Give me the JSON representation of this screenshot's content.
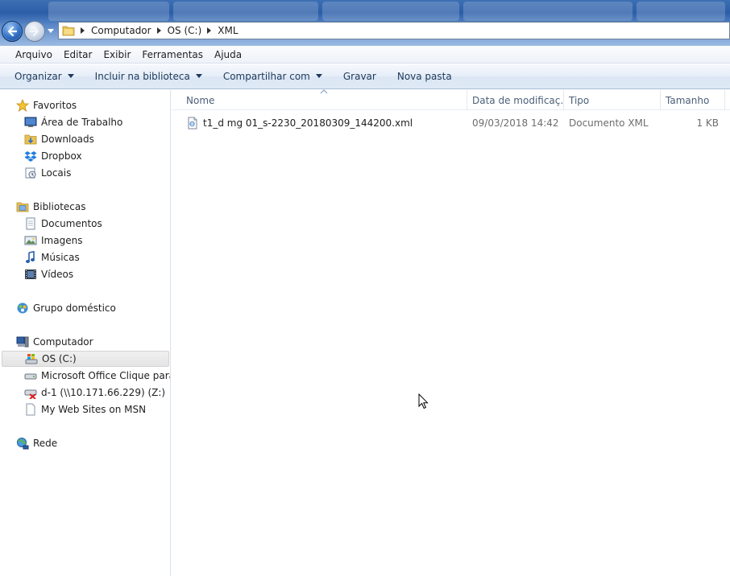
{
  "address": {
    "crumbs": [
      "Computador",
      "OS (C:)",
      "XML"
    ]
  },
  "menu": [
    "Arquivo",
    "Editar",
    "Exibir",
    "Ferramentas",
    "Ajuda"
  ],
  "commands": [
    {
      "label": "Organizar",
      "dropdown": true
    },
    {
      "label": "Incluir na biblioteca",
      "dropdown": true
    },
    {
      "label": "Compartilhar com",
      "dropdown": true
    },
    {
      "label": "Gravar",
      "dropdown": false
    },
    {
      "label": "Nova pasta",
      "dropdown": false
    }
  ],
  "nav": {
    "favorites": {
      "label": "Favoritos",
      "items": [
        "Área de Trabalho",
        "Downloads",
        "Dropbox",
        "Locais"
      ]
    },
    "libraries": {
      "label": "Bibliotecas",
      "items": [
        "Documentos",
        "Imagens",
        "Músicas",
        "Vídeos"
      ]
    },
    "homegroup": {
      "label": "Grupo doméstico"
    },
    "computer": {
      "label": "Computador",
      "items": [
        "OS (C:)",
        "Microsoft Office Clique para Executar",
        "d-1 (\\\\10.171.66.229) (Z:)",
        "My Web Sites on MSN"
      ],
      "selected": "OS (C:)"
    },
    "network": {
      "label": "Rede"
    }
  },
  "columns": {
    "name": "Nome",
    "date": "Data de modificaç...",
    "type": "Tipo",
    "size": "Tamanho"
  },
  "files": [
    {
      "name": "t1_d mg 01_s-2230_20180309_144200.xml",
      "date": "09/03/2018 14:42",
      "type": "Documento XML",
      "size": "1 KB"
    }
  ],
  "colors": {
    "accent": "#2b5ea8",
    "cmd_text": "#1e395b",
    "header_text": "#4c607a"
  }
}
